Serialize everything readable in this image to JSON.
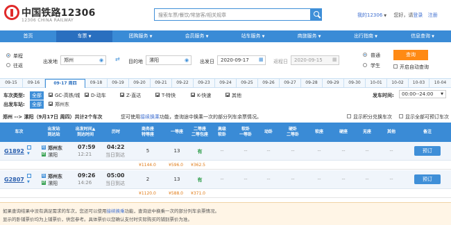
{
  "header": {
    "brand": "中国铁路12306",
    "brand_sub": "12306 CHINA RAILWAY",
    "search_placeholder": "搜索车票/餐饮/常旅客/相关规章",
    "my12306": "我的12306",
    "greeting": "您好，请",
    "login": "登录",
    "register": "注册"
  },
  "nav": [
    {
      "label": "首页",
      "caret": false
    },
    {
      "label": "车票",
      "caret": true
    },
    {
      "label": "团购服务",
      "caret": true
    },
    {
      "label": "会员服务",
      "caret": true
    },
    {
      "label": "站车服务",
      "caret": true
    },
    {
      "label": "商旅服务",
      "caret": true
    },
    {
      "label": "出行指南",
      "caret": true
    },
    {
      "label": "信息查询",
      "caret": true
    }
  ],
  "query": {
    "one_way": "单程",
    "round_trip": "往返",
    "from_label": "出发地",
    "from_value": "郑州",
    "to_label": "目的地",
    "to_value": "漯阳",
    "depart_label": "出发日",
    "depart_value": "2020-09-17",
    "return_label": "返程日",
    "return_value": "2020-09-15",
    "normal": "普通",
    "student": "学生",
    "query_button": "查询",
    "auto_query": "开启自动查询"
  },
  "dates": [
    "09-15",
    "09-16",
    "09-17 周四",
    "09-18",
    "09-19",
    "09-20",
    "09-21",
    "09-22",
    "09-23",
    "09-24",
    "09-25",
    "09-26",
    "09-27",
    "09-28",
    "09-29",
    "09-30",
    "10-01",
    "10-02",
    "10-03",
    "10-04"
  ],
  "filters": {
    "type_label": "车次类型:",
    "all": "全部",
    "types": [
      "GC-高铁/城",
      "D-动车",
      "Z-直达",
      "T-特快",
      "K-快速",
      "其他"
    ],
    "station_label": "出发车站:",
    "station_all": "全部",
    "station": "郑州东",
    "time_label": "发车时间:",
    "time_value": "00:00--24:00"
  },
  "summary": {
    "route": "郑州 --> 漯阳（9月17日 周四）共计2个车次",
    "hint_pre": "您可使用",
    "hint_link": "接续换乘",
    "hint_post": "功能，查询途中换乘一次的部分列车余票情况。",
    "show_points": "显示积分兑换车次",
    "show_all": "显示全部可预订车次"
  },
  "columns": [
    "车次",
    "出发站\n到达站",
    "出发时间▲\n到达时间",
    "历时",
    "商务座\n特等座",
    "一等座",
    "二等座\n二等包座",
    "高级\n软卧",
    "软卧\n一等卧",
    "动卧",
    "硬卧\n二等卧",
    "软座",
    "硬座",
    "无座",
    "其他",
    "备注"
  ],
  "trains": [
    {
      "code": "G1892",
      "from": "郑州东",
      "to": "漯阳",
      "depart": "07:59",
      "arrive": "12:21",
      "duration": "04:22",
      "arrival_note": "当日到达",
      "business": "5",
      "first": "13",
      "second": "有",
      "others": [
        "--",
        "--",
        "--",
        "--",
        "--",
        "--",
        "--",
        "--"
      ],
      "book": "预订",
      "prices": [
        "¥1144.0",
        "¥596.0",
        "¥362.5"
      ]
    },
    {
      "code": "G2807",
      "from": "郑州东",
      "to": "漯阳",
      "depart": "09:26",
      "arrive": "14:26",
      "duration": "05:00",
      "arrival_note": "当日到达",
      "business": "2",
      "first": "13",
      "second": "有",
      "others": [
        "--",
        "--",
        "--",
        "--",
        "--",
        "--",
        "--",
        "--"
      ],
      "book": "预订",
      "prices": [
        "¥1120.0",
        "¥588.0",
        "¥371.0"
      ]
    }
  ],
  "notice": {
    "line1_pre": "如果查询结果中没有满足需求的车次，您还可以使用",
    "line1_link": "接续换乘",
    "line1_post": "功能，查询途中换乘一次的部分列车余票情况。",
    "line2": "显示的卧铺票价均为上铺票价，供您参考。具体票价以您确认支付时实际购买的铺别票价为准。"
  },
  "colors": {
    "nav": "#3a8bd6",
    "accent": "#ff8a14",
    "link": "#3f6fd0"
  }
}
